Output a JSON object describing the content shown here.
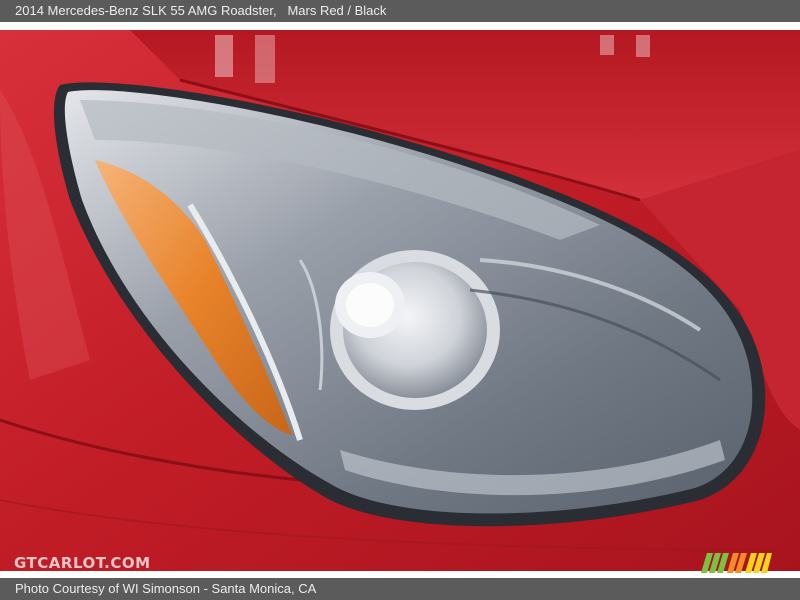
{
  "header": {
    "car_title": "2014 Mercedes-Benz SLK 55 AMG Roadster,",
    "color": "Mars Red / Black"
  },
  "photo": {
    "watermark": "GTCARLOT.COM"
  },
  "footer": {
    "credit": "Photo Courtesy of WI Simonson - Santa Monica, CA"
  },
  "colors": {
    "paint": "#c8202a",
    "bar": "#5b5b5b",
    "amber": "#e8832a"
  }
}
